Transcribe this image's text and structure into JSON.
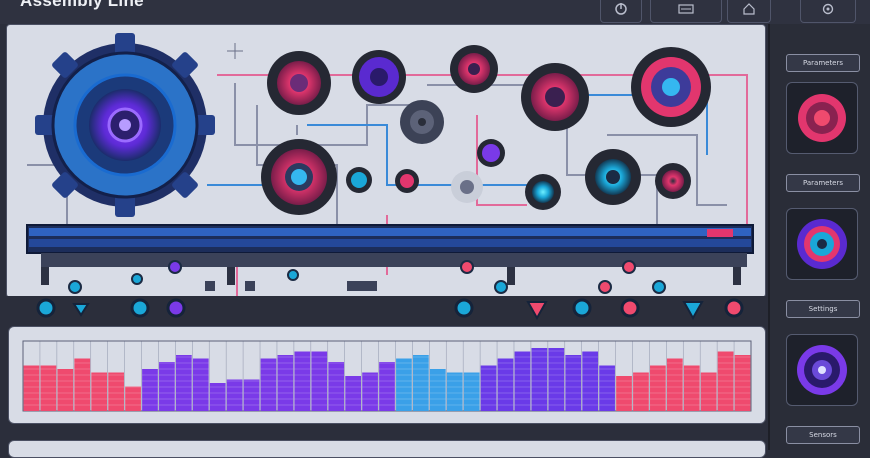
{
  "app": {
    "title": "Assembly Line"
  },
  "colors": {
    "accent_blue": "#3aa0e8",
    "accent_purple": "#7a3ae8",
    "accent_pink": "#ef4a6e",
    "background": "#2b2e3b",
    "panel": "#d8dce6"
  },
  "toolbar": {
    "icons": [
      "power-icon",
      "document-icon",
      "home-icon",
      "settings-icon"
    ]
  },
  "right_panel": {
    "labels": [
      "Parameters",
      "Parameters",
      "Settings",
      "Sensors"
    ]
  },
  "equalizer": {
    "levels": [
      0.65,
      0.65,
      0.6,
      0.75,
      0.55,
      0.55,
      0.35,
      0.6,
      0.7,
      0.8,
      0.75,
      0.4,
      0.45,
      0.45,
      0.75,
      0.8,
      0.85,
      0.85,
      0.7,
      0.5,
      0.55,
      0.7,
      0.75,
      0.8,
      0.6,
      0.55,
      0.55,
      0.65,
      0.75,
      0.85,
      0.9,
      0.9,
      0.8,
      0.85,
      0.65,
      0.5,
      0.55,
      0.65,
      0.75,
      0.65,
      0.55,
      0.85,
      0.8
    ]
  }
}
